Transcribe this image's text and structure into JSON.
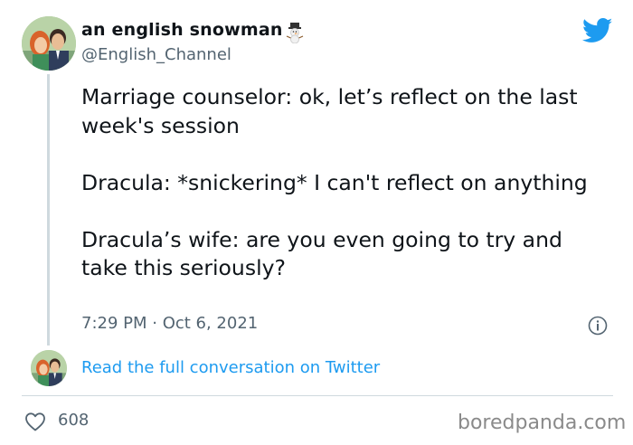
{
  "author": {
    "display_name": "an english snowman",
    "handle": "@English_Channel",
    "name_emoji": "snowman-icon"
  },
  "tweet": {
    "paragraphs": [
      "Marriage counselor: ok, let’s reflect on the last week's session",
      "Dracula: *snickering* I can't reflect on anything",
      "Dracula’s wife: are you even going to try and take this seriously?"
    ],
    "timestamp": "7:29 PM · Oct 6, 2021"
  },
  "thread_link": "Read the full conversation on Twitter",
  "engagement": {
    "likes": "608"
  },
  "watermark": "boredpanda.com",
  "colors": {
    "twitter_blue": "#1d9bf0",
    "text_primary": "#0f1419",
    "text_secondary": "#536471",
    "divider": "#cfd9de"
  }
}
